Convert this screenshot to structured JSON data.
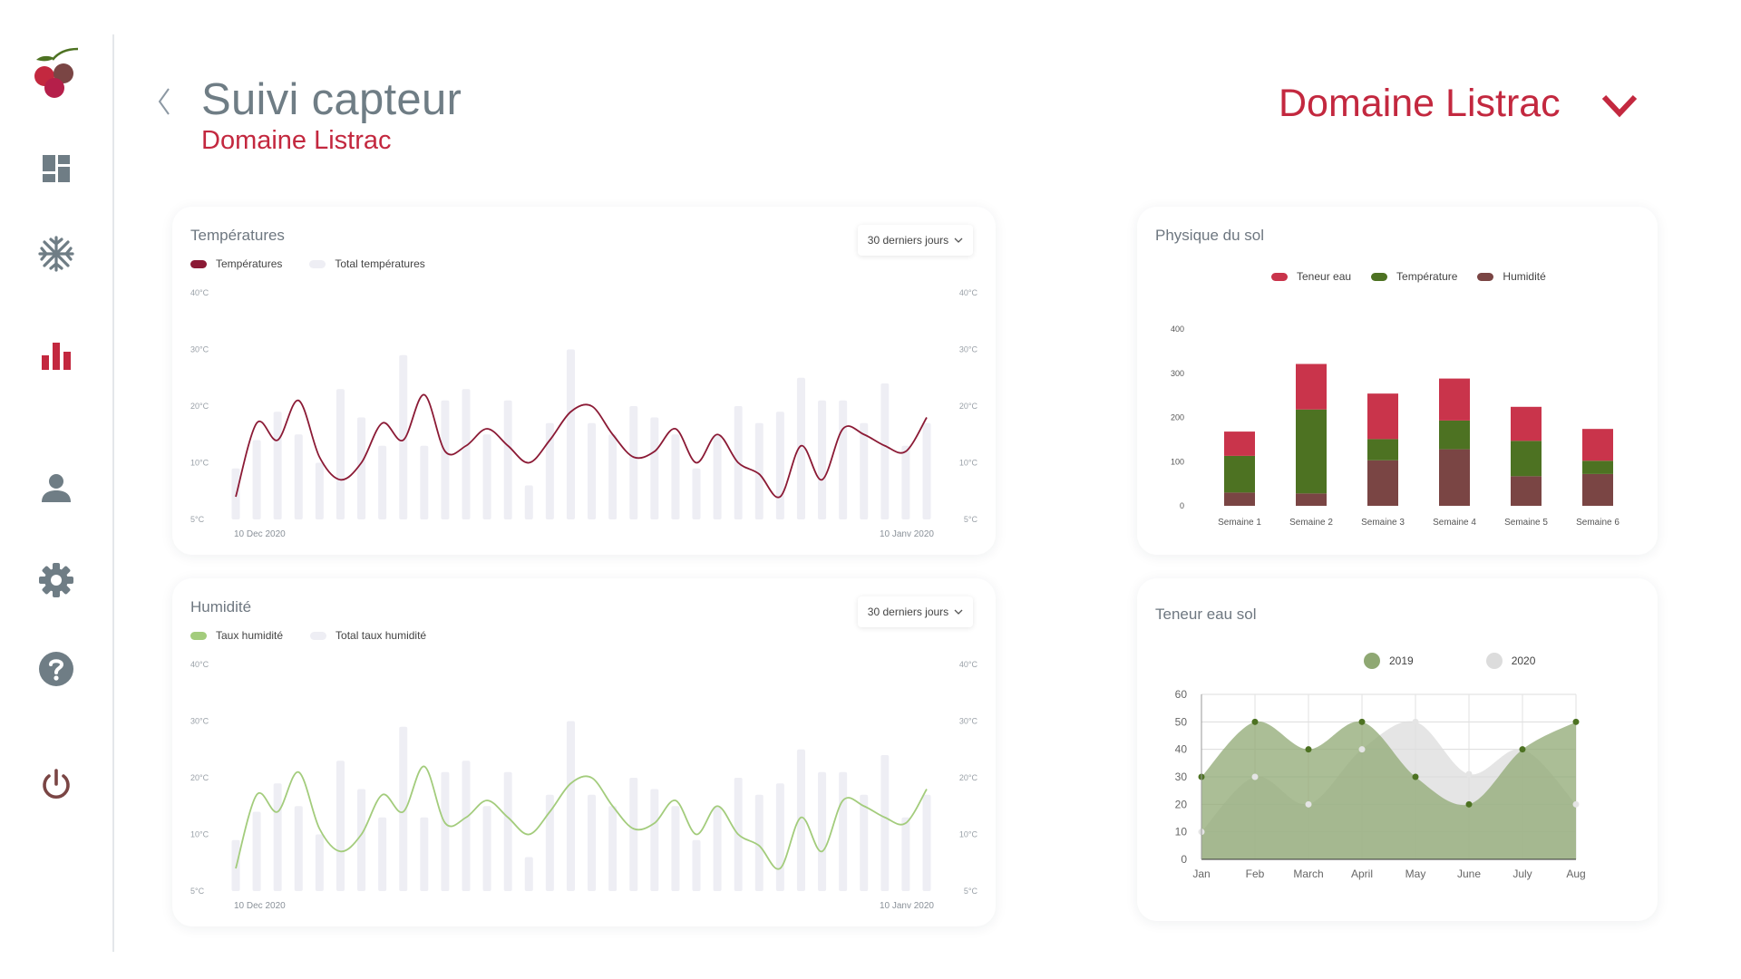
{
  "sidebar": {
    "items": [
      {
        "name": "logo",
        "icon": "cherry-logo-icon"
      },
      {
        "name": "dashboard",
        "icon": "dashboard-icon"
      },
      {
        "name": "frost",
        "icon": "snowflake-icon"
      },
      {
        "name": "stats",
        "icon": "bar-chart-icon",
        "active": true
      },
      {
        "name": "profile",
        "icon": "user-icon"
      },
      {
        "name": "settings",
        "icon": "gear-icon"
      },
      {
        "name": "help",
        "icon": "help-icon"
      },
      {
        "name": "logout",
        "icon": "power-icon"
      }
    ]
  },
  "header": {
    "title": "Suivi capteur",
    "subtitle": "Domaine Listrac",
    "domain_select": "Domaine Listrac"
  },
  "colors": {
    "accent": "#c3283f",
    "title_grey": "#6f7d85",
    "temp_line": "#8b1a35",
    "humidity_line": "#a3cc7c",
    "bar_grey": "#eeeef4",
    "teneur_eau": "#c9344b",
    "temperature_green": "#4d7222",
    "humidite_brown": "#7a4544",
    "area_2019": "#8fa873",
    "area_2020": "#dcdcdc"
  },
  "temperature_card": {
    "title": "Températures",
    "range": "30 derniers jours",
    "legend": [
      {
        "label": "Températures",
        "color": "#8b1a35"
      },
      {
        "label": "Total températures",
        "color": "#eeeef4"
      }
    ]
  },
  "humidity_card": {
    "title": "Humidité",
    "range": "30 derniers jours",
    "legend": [
      {
        "label": "Taux humidité",
        "color": "#a3cc7c"
      },
      {
        "label": "Total taux humidité",
        "color": "#eeeef4"
      }
    ]
  },
  "soil_card": {
    "title": "Physique du sol",
    "legend": [
      {
        "label": "Teneur eau",
        "color": "#c9344b"
      },
      {
        "label": "Température",
        "color": "#4d7222"
      },
      {
        "label": "Humidité",
        "color": "#7a4544"
      }
    ]
  },
  "water_card": {
    "title": "Teneur eau sol",
    "legend": [
      {
        "label": "2019",
        "color": "#8fa873"
      },
      {
        "label": "2020",
        "color": "#dcdcdc"
      }
    ]
  },
  "chart_data": [
    {
      "id": "temperatures",
      "type": "line",
      "title": "Températures",
      "y_ticks": [
        "40°C",
        "30°C",
        "20°C",
        "10°C",
        "5°C"
      ],
      "x_labels": [
        "10 Dec 2020",
        "10 Janv 2020"
      ],
      "ylim": [
        0,
        40
      ],
      "series": [
        {
          "name": "Températures",
          "type": "line",
          "values": [
            4,
            17,
            14,
            21,
            11,
            7,
            10,
            17,
            14,
            22,
            12,
            13,
            16,
            13,
            10,
            14,
            19,
            20,
            15,
            11,
            12,
            16,
            10,
            15,
            10,
            8,
            4,
            13,
            7,
            16,
            15,
            13,
            12,
            18
          ]
        },
        {
          "name": "Total températures",
          "type": "bar",
          "values": [
            9,
            14,
            19,
            15,
            10,
            23,
            18,
            13,
            29,
            13,
            21,
            23,
            15,
            21,
            6,
            17,
            30,
            17,
            15,
            20,
            18,
            15,
            9,
            15,
            20,
            17,
            19,
            25,
            21,
            21,
            17,
            24,
            13,
            17
          ]
        }
      ]
    },
    {
      "id": "humidite",
      "type": "line",
      "title": "Humidité",
      "y_ticks": [
        "40°C",
        "30°C",
        "20°C",
        "10°C",
        "5°C"
      ],
      "x_labels": [
        "10 Dec 2020",
        "10 Janv 2020"
      ],
      "ylim": [
        0,
        40
      ],
      "series": [
        {
          "name": "Taux humidité",
          "type": "line",
          "values": [
            4,
            17,
            14,
            21,
            11,
            7,
            10,
            17,
            14,
            22,
            12,
            13,
            16,
            13,
            10,
            14,
            19,
            20,
            15,
            11,
            12,
            16,
            10,
            15,
            10,
            8,
            4,
            13,
            7,
            16,
            15,
            13,
            12,
            18
          ]
        },
        {
          "name": "Total taux humidité",
          "type": "bar",
          "values": [
            9,
            14,
            19,
            15,
            10,
            23,
            18,
            13,
            29,
            13,
            21,
            23,
            15,
            21,
            6,
            17,
            30,
            17,
            15,
            20,
            18,
            15,
            9,
            15,
            20,
            17,
            19,
            25,
            21,
            21,
            17,
            24,
            13,
            17
          ]
        }
      ]
    },
    {
      "id": "physique_sol",
      "type": "bar",
      "stacked": true,
      "title": "Physique du sol",
      "categories": [
        "Semaine 1",
        "Semaine 2",
        "Semaine 3",
        "Semaine 4",
        "Semaine 5",
        "Semaine 6"
      ],
      "y_ticks": [
        0,
        100,
        200,
        300,
        400
      ],
      "ylim": [
        0,
        400
      ],
      "series": [
        {
          "name": "Humidité",
          "values": [
            30,
            28,
            103,
            128,
            67,
            72
          ]
        },
        {
          "name": "Température",
          "values": [
            83,
            190,
            48,
            65,
            80,
            30
          ]
        },
        {
          "name": "Teneur eau",
          "values": [
            55,
            103,
            103,
            95,
            77,
            72
          ]
        }
      ]
    },
    {
      "id": "teneur_eau_sol",
      "type": "area",
      "title": "Teneur eau sol",
      "categories": [
        "Jan",
        "Feb",
        "March",
        "April",
        "May",
        "June",
        "July",
        "Aug"
      ],
      "y_ticks": [
        0,
        10,
        20,
        30,
        40,
        50,
        60
      ],
      "ylim": [
        0,
        60
      ],
      "grid": true,
      "series": [
        {
          "name": "2019",
          "values": [
            30,
            50,
            40,
            50,
            30,
            20,
            40,
            50
          ]
        },
        {
          "name": "2020",
          "values": [
            10,
            30,
            20,
            40,
            50,
            31,
            40,
            20
          ]
        }
      ]
    }
  ]
}
